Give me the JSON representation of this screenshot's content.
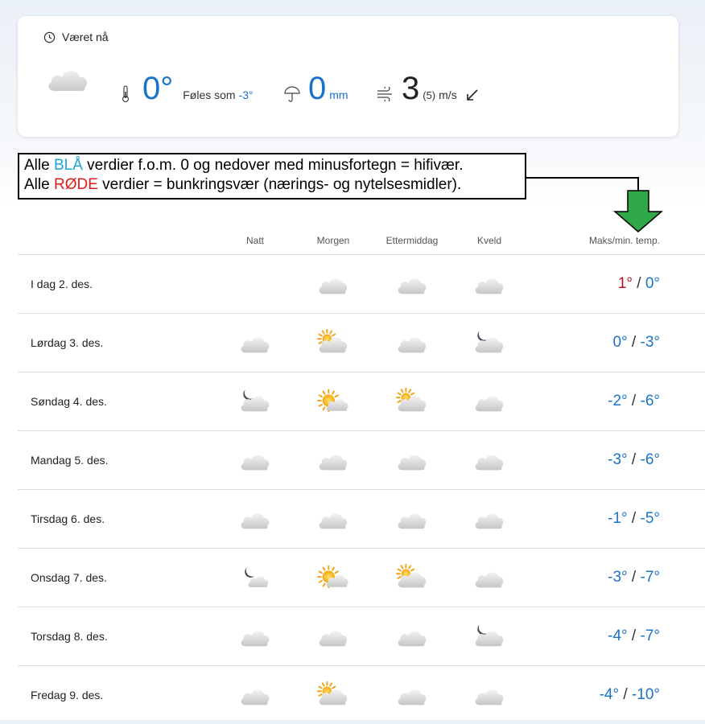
{
  "now": {
    "heading": "Været nå",
    "condition_icon": "cloud-icon",
    "temperature": "0°",
    "feels_like_label": "Føles som",
    "feels_like_value": "-3°",
    "precip_value": "0",
    "precip_unit": "mm",
    "wind_value": "3",
    "wind_gust": "(5)",
    "wind_unit": "m/s"
  },
  "annotation": {
    "line1_a": "Alle ",
    "line1_b": "BLÅ",
    "line1_c": " verdier f.o.m. 0 og nedover med  minusfortegn = hifivær.",
    "line2_a": "Alle ",
    "line2_b": "RØDE",
    "line2_c": " verdier = bunkringsvær (nærings- og nytelsesmidler)."
  },
  "columns": {
    "night": "Natt",
    "morning": "Morgen",
    "afternoon": "Ettermiddag",
    "evening": "Kveld",
    "maxmin": "Maks/min. temp."
  },
  "forecast": [
    {
      "day": "I dag 2. des.",
      "icons": [
        "",
        "cloud",
        "cloud",
        "cloud"
      ],
      "max": "1°",
      "min": "0°",
      "max_color": "red",
      "min_color": "blue"
    },
    {
      "day": "Lørdag 3. des.",
      "icons": [
        "cloud",
        "sun-cloud",
        "cloud",
        "moon-cloud"
      ],
      "max": "0°",
      "min": "-3°",
      "max_color": "blue",
      "min_color": "blue"
    },
    {
      "day": "Søndag 4. des.",
      "icons": [
        "moon-cloud",
        "sun-partly",
        "sun-cloud",
        "cloud"
      ],
      "max": "-2°",
      "min": "-6°",
      "max_color": "blue",
      "min_color": "blue"
    },
    {
      "day": "Mandag 5. des.",
      "icons": [
        "cloud",
        "cloud",
        "cloud",
        "cloud"
      ],
      "max": "-3°",
      "min": "-6°",
      "max_color": "blue",
      "min_color": "blue"
    },
    {
      "day": "Tirsdag 6. des.",
      "icons": [
        "cloud",
        "cloud",
        "cloud",
        "cloud"
      ],
      "max": "-1°",
      "min": "-5°",
      "max_color": "blue",
      "min_color": "blue"
    },
    {
      "day": "Onsdag 7. des.",
      "icons": [
        "moon-partly",
        "sun-partly",
        "sun-cloud",
        "cloud"
      ],
      "max": "-3°",
      "min": "-7°",
      "max_color": "blue",
      "min_color": "blue"
    },
    {
      "day": "Torsdag 8. des.",
      "icons": [
        "cloud",
        "cloud",
        "cloud",
        "moon-cloud"
      ],
      "max": "-4°",
      "min": "-7°",
      "max_color": "blue",
      "min_color": "blue"
    },
    {
      "day": "Fredag 9. des.",
      "icons": [
        "cloud",
        "sun-cloud",
        "cloud",
        "cloud"
      ],
      "max": "-4°",
      "min": "-10°",
      "max_color": "blue",
      "min_color": "blue"
    }
  ],
  "colors": {
    "blue": "#1a73c8",
    "red": "#b81221",
    "arrow_green": "#2fa84a"
  }
}
